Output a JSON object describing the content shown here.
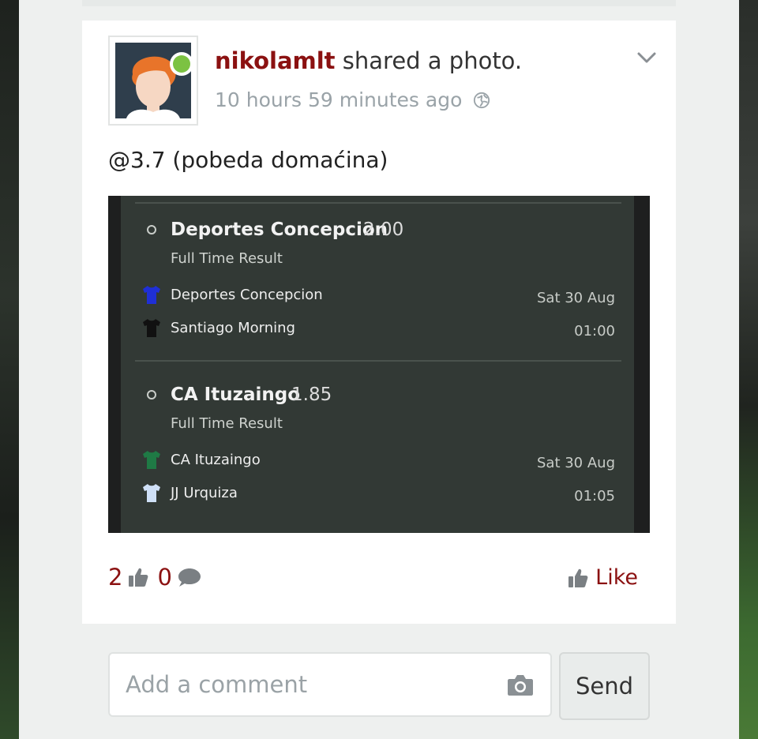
{
  "post": {
    "author": "nikolamlt",
    "action": "shared a photo.",
    "time": "10 hours 59 minutes ago",
    "text": "@3.7 (pobeda domaćina)",
    "like_count": "2",
    "comment_count": "0",
    "like_label": "Like"
  },
  "photo": {
    "picks": [
      {
        "selection": "Deportes Concepcion",
        "odds": "2.00",
        "market": "Full Time Result",
        "home": "Deportes Concepcion",
        "away": "Santiago Morning",
        "date": "Sat 30 Aug",
        "time": "01:00",
        "home_shirt_color": "#1f2fd6",
        "away_shirt_color": "#111111"
      },
      {
        "selection": "CA Ituzaingo",
        "odds": "1.85",
        "market": "Full Time Result",
        "home": "CA Ituzaingo",
        "away": "JJ Urquiza",
        "date": "Sat 30 Aug",
        "time": "01:05",
        "home_shirt_color": "#1f7a45",
        "away_shirt_color": "#cfe0f7"
      }
    ]
  },
  "comment": {
    "placeholder": "Add a comment",
    "send_label": "Send"
  },
  "colors": {
    "accent": "#8b1111",
    "online": "#7cc242"
  },
  "icons": [
    "chevron-down-icon",
    "globe-icon",
    "thumbs-up-icon",
    "comment-bubble-icon",
    "camera-icon",
    "shirt-icon"
  ]
}
